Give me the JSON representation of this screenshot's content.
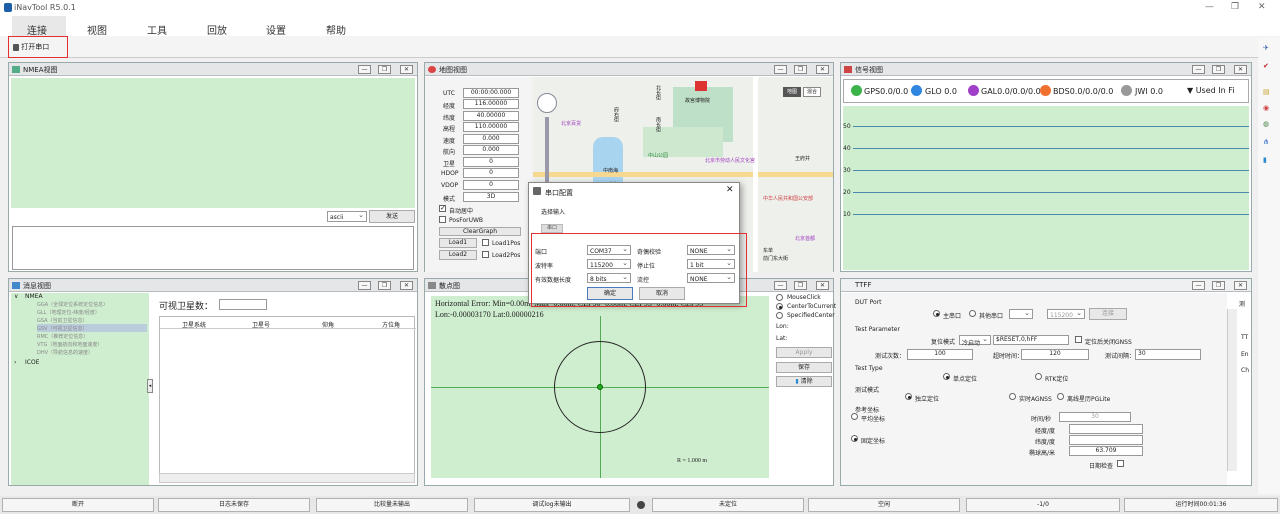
{
  "app": {
    "title": "iNavTool R5.0.1"
  },
  "menu": [
    "连接",
    "视图",
    "工具",
    "回放",
    "设置",
    "帮助"
  ],
  "toolbar": {
    "open_port": "打开串口"
  },
  "panels": {
    "nmea": {
      "title": "NMEA视图",
      "encoding": "ascii",
      "send": "发送"
    },
    "map": {
      "title": "地图视图",
      "fields": [
        {
          "label": "UTC",
          "value": "00:00:00.000"
        },
        {
          "label": "经度",
          "value": "116.00000"
        },
        {
          "label": "纬度",
          "value": "40.00000"
        },
        {
          "label": "高程",
          "value": "110.00000"
        },
        {
          "label": "速度",
          "value": "0.000"
        },
        {
          "label": "航向",
          "value": "0.000"
        },
        {
          "label": "卫星",
          "value": "0"
        },
        {
          "label": "HDOP",
          "value": "0"
        },
        {
          "label": "VDOP",
          "value": "0"
        },
        {
          "label": "模式",
          "value": "3D"
        }
      ],
      "auto_center": "自动居中",
      "pos_uwb": "PosForUWB",
      "clear_graph": "ClearGraph",
      "load1": "Load1",
      "load1pos": "Load1Pos",
      "load2": "Load2",
      "load2pos": "Load2Pos",
      "map_labels": [
        "故宫博物院",
        "北京百货",
        "北京市劳动人民文化宫",
        "中山公园",
        "中华人民共和国公安部",
        "王府井",
        "北京首都",
        "东单",
        "前门东大街",
        "地图",
        "混合",
        "北长街",
        "南长街",
        "中南海",
        "南海",
        "府右街"
      ]
    },
    "signal": {
      "title": "信号视图",
      "legend": [
        {
          "name": "GPS",
          "value": "0.0/0.0",
          "color": "#3cb34a"
        },
        {
          "name": "GLO",
          "value": "0.0",
          "color": "#2f86e0"
        },
        {
          "name": "GAL",
          "value": "0.0/0.0/0.0",
          "color": "#a040c8"
        },
        {
          "name": "BDS",
          "value": "0.0/0.0/0.0",
          "color": "#f07030"
        },
        {
          "name": "JWI",
          "value": "0.0",
          "color": "#999999"
        }
      ],
      "used_in_fix": "Used In Fi",
      "yticks": [
        "50",
        "40",
        "30",
        "20",
        "10"
      ]
    },
    "msg": {
      "title": "消息视图",
      "nmea_root": "NMEA",
      "nmea_items": [
        "GGA（全球定位系统定位信息）",
        "GLL（地理定位-纬度/经度）",
        "GSA（当前卫星信息）",
        "GSV（可视卫星信息）",
        "RMC（推荐定位信息）",
        "VTG（地面航向和地面速度）",
        "DHV（导航信息的速度）"
      ],
      "icoe": "ICOE",
      "visible_sats": "可视卫星数：",
      "cols": [
        "卫星系统",
        "卫星号",
        "仰角",
        "方位角"
      ]
    },
    "scatter": {
      "title": "散点图",
      "line1": "Horizontal Error: Min=0.00m, Max=0.00m, CEP50=0.00m, CEP95=0.00m, CEP95",
      "line2": "Lon:-0.00003170 Lat:0.00000216",
      "radius": "R = 1.000 m",
      "options": [
        "MouseClick",
        "CenterToCurrent",
        "SpecifiedCenter"
      ],
      "lon": "Lon:",
      "lat": "Lat:",
      "apply": "Apply",
      "save": "保存",
      "clear": "清除"
    },
    "ttff": {
      "title": "TTFF",
      "dut_port": "DUT Port",
      "main_port": "主串口",
      "other_port": "其他串口",
      "baud": "115200",
      "connect": "连接",
      "test_param": "Test Parameter",
      "reset_mode": "复位模式",
      "reset_val": "冷启动",
      "reset_cmd": "$RESET,0,hFF",
      "close_gnss": "定位后关闭GNSS",
      "count_label": "测试次数：",
      "count": "100",
      "timeout_label": "超时时间：",
      "timeout": "120",
      "interval_label": "测试间隔：",
      "interval": "30",
      "test_type": "Test Type",
      "single": "单点定位",
      "rtk": "RTK定位",
      "test_mode": "测试模式",
      "independent": "独立定位",
      "agnss": "实时AGNSS",
      "ephemeris": "离线星历PGLite",
      "ref_coord": "参考坐标",
      "avg_coord": "平均坐标",
      "fixed_coord": "固定坐标",
      "time_sec": "时间/秒",
      "time_val": "30",
      "lon_deg": "经度/度",
      "lat_deg": "纬度/度",
      "alt_m": "椭球高/米",
      "alt_val": "63.709",
      "date_check": "日期检查",
      "right_labels": [
        "测",
        "TT",
        "En",
        "Ch"
      ]
    }
  },
  "dialog": {
    "title": "串口配置",
    "select_input": "选择输入",
    "port_tab": "串口",
    "port_label": "端口",
    "port": "COM37",
    "parity_label": "奇偶校验",
    "parity": "NONE",
    "baud_label": "波特率",
    "baud": "115200",
    "stop_label": "停止位",
    "stop": "1 bit",
    "data_label": "有效数据长度",
    "data": "8 bits",
    "flow_label": "流控",
    "flow": "NONE",
    "ok": "确定",
    "cancel": "取消"
  },
  "status": [
    "断开",
    "日志未保存",
    "比较量未输出",
    "调试log未输出",
    "",
    "未定位",
    "空闲",
    "-1/0",
    "运行时间00:01:36"
  ]
}
